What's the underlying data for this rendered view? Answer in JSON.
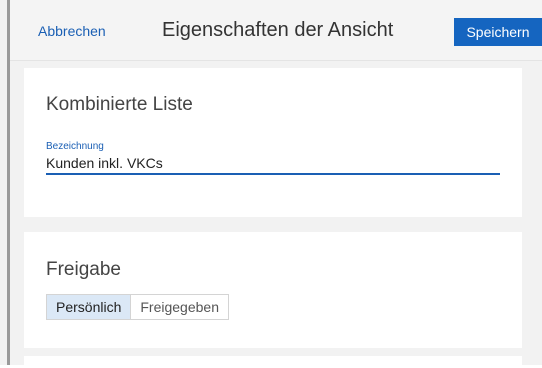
{
  "header": {
    "cancel_label": "Abbrechen",
    "title": "Eigenschaften der Ansicht",
    "save_label": "Speichern"
  },
  "list_section": {
    "title": "Kombinierte Liste",
    "field_label": "Bezeichnung",
    "field_value": "Kunden inkl. VKCs"
  },
  "share_section": {
    "title": "Freigabe",
    "options": [
      "Persönlich",
      "Freigegeben"
    ],
    "selected": "Persönlich"
  },
  "colors": {
    "accent": "#1565c0",
    "link": "#1a5fb4",
    "selected_option_bg": "#dbe8f6"
  }
}
